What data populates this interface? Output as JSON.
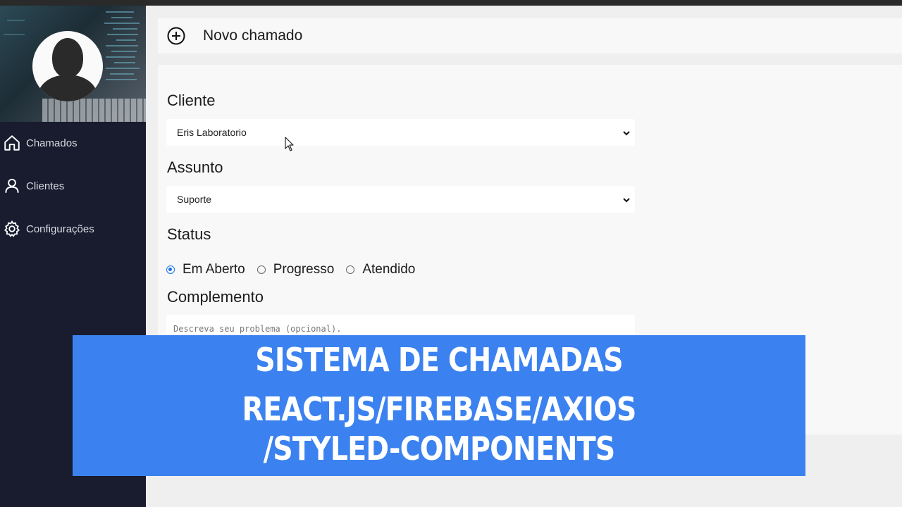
{
  "sidebar": {
    "items": [
      {
        "label": "Chamados",
        "icon": "home-icon"
      },
      {
        "label": "Clientes",
        "icon": "user-icon"
      },
      {
        "label": "Configurações",
        "icon": "gear-icon"
      }
    ]
  },
  "header": {
    "title": "Novo chamado",
    "icon": "plus-circle-icon"
  },
  "form": {
    "cliente_label": "Cliente",
    "cliente_value": "Eris Laboratorio",
    "assunto_label": "Assunto",
    "assunto_value": "Suporte",
    "status_label": "Status",
    "status_options": [
      {
        "label": "Em Aberto",
        "checked": true
      },
      {
        "label": "Progresso",
        "checked": false
      },
      {
        "label": "Atendido",
        "checked": false
      }
    ],
    "complemento_label": "Complemento",
    "complemento_placeholder": "Descreva seu problema (opcional)."
  },
  "banner": {
    "line1": "SISTEMA DE CHAMADAS",
    "line2": "REACT.JS/FIREBASE/AXIOS",
    "line3": "/STYLED-COMPONENTS"
  },
  "colors": {
    "sidebar_bg": "#181c2e",
    "banner_bg": "#3b82f0",
    "radio_accent": "#1a73e8"
  }
}
